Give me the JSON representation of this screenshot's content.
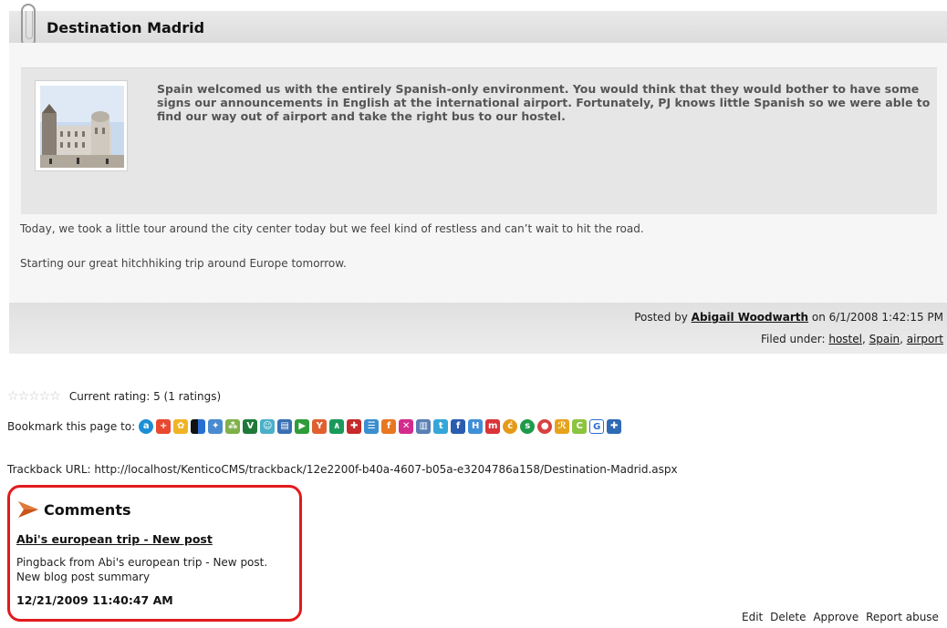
{
  "post": {
    "title": "Destination Madrid",
    "summary": "Spain welcomed us with the entirely Spanish-only environment. You would think that they would bother to have some signs our announcements in English at the international airport. Fortunately, PJ knows little Spanish so we were able to find our way out of airport and take the right bus to our hostel.",
    "paragraph1": "Today, we took a little tour around the city center today but we feel kind of restless and can’t wait to hit the road.",
    "paragraph2": "Starting our great hitchhiking trip around Europe tomorrow."
  },
  "meta": {
    "posted_by_prefix": "Posted by",
    "author": "Abigail Woodwarth",
    "posted_on_text": "on 6/1/2008 1:42:15 PM",
    "filed_under_label": "Filed under:",
    "tags": [
      "hostel",
      "Spain",
      "airport"
    ]
  },
  "rating": {
    "text": "Current rating: 5 (1 ratings)",
    "stars_total": 5
  },
  "bookmark": {
    "label": "Bookmark this page to:",
    "services": [
      "ask",
      "google",
      "delicious",
      "digg",
      "myspace",
      "mixx",
      "newsvine",
      "reddit",
      "mister-wong",
      "slashdot",
      "yahoo",
      "technorati",
      "live",
      "facebook",
      "stumbleupon",
      "furl",
      "twitter",
      "linkedin",
      "blinklist",
      "mixx",
      "diigo",
      "spurl",
      "simpy",
      "blogmarks",
      "google-bookmarks",
      "more"
    ]
  },
  "trackback": {
    "label": "Trackback URL:",
    "url": "http://localhost/KenticoCMS/trackback/12e2200f-b40a-4607-b05a-e3204786a158/Destination-Madrid.aspx"
  },
  "comments": {
    "title": "Comments",
    "items": [
      {
        "title": "Abi's european trip - New post",
        "line1": "Pingback from Abi's european trip - New post.",
        "line2": "New blog post summary",
        "date": "12/21/2009 11:40:47 AM",
        "actions": [
          "Edit",
          "Delete",
          "Approve",
          "Report abuse"
        ]
      }
    ]
  },
  "colors": {
    "highlight_border": "#e3191b",
    "header_bg": "#dcdcdc",
    "summary_bg": "#e6e6e6"
  }
}
